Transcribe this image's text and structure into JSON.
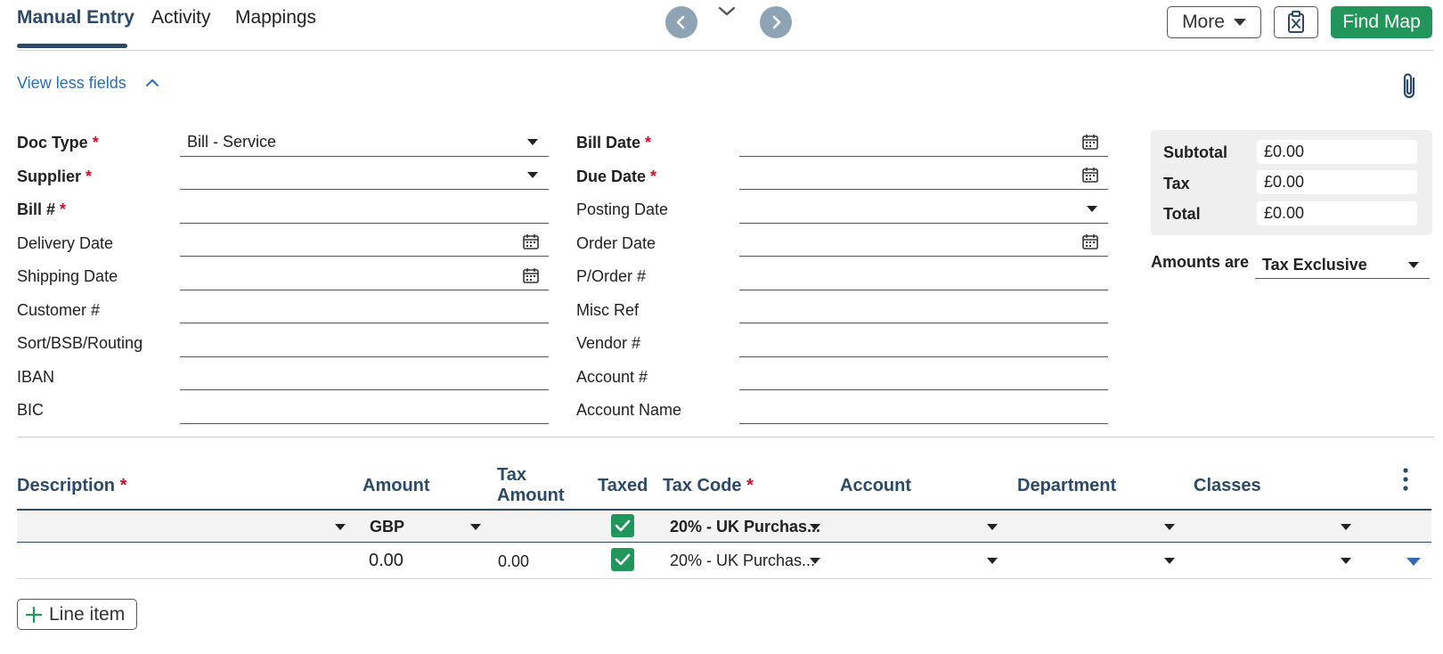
{
  "tabs": [
    {
      "label": "Manual Entry",
      "active": true
    },
    {
      "label": "Activity",
      "active": false
    },
    {
      "label": "Mappings",
      "active": false
    }
  ],
  "toolbar": {
    "more_label": "More",
    "find_map_label": "Find Map",
    "brand_green": "#22965a",
    "nav_gray": "#8ea3b3"
  },
  "view_toggle_label": "View less fields",
  "required_mark": "*",
  "left_fields": [
    {
      "label": "Doc Type",
      "required": true,
      "value": "Bill - Service",
      "control": "dropdown"
    },
    {
      "label": "Supplier",
      "required": true,
      "value": "",
      "control": "dropdown"
    },
    {
      "label": "Bill #",
      "required": true,
      "value": "",
      "control": "text"
    },
    {
      "label": "Delivery Date",
      "required": false,
      "value": "",
      "control": "date"
    },
    {
      "label": "Shipping Date",
      "required": false,
      "value": "",
      "control": "date"
    },
    {
      "label": "Customer #",
      "required": false,
      "value": "",
      "control": "text"
    },
    {
      "label": "Sort/BSB/Routing",
      "required": false,
      "value": "",
      "control": "text"
    },
    {
      "label": "IBAN",
      "required": false,
      "value": "",
      "control": "text"
    },
    {
      "label": "BIC",
      "required": false,
      "value": "",
      "control": "text"
    }
  ],
  "right_fields": [
    {
      "label": "Bill Date",
      "required": true,
      "value": "",
      "control": "date"
    },
    {
      "label": "Due Date",
      "required": true,
      "value": "",
      "control": "date"
    },
    {
      "label": "Posting Date",
      "required": false,
      "value": "",
      "control": "dropdown"
    },
    {
      "label": "Order Date",
      "required": false,
      "value": "",
      "control": "date"
    },
    {
      "label": "P/Order #",
      "required": false,
      "value": "",
      "control": "text"
    },
    {
      "label": "Misc Ref",
      "required": false,
      "value": "",
      "control": "text"
    },
    {
      "label": "Vendor #",
      "required": false,
      "value": "",
      "control": "text"
    },
    {
      "label": "Account #",
      "required": false,
      "value": "",
      "control": "text"
    },
    {
      "label": "Account Name",
      "required": false,
      "value": "",
      "control": "text"
    }
  ],
  "totals": {
    "subtotal_label": "Subtotal",
    "subtotal_value": "£0.00",
    "tax_label": "Tax",
    "tax_value": "£0.00",
    "total_label": "Total",
    "total_value": "£0.00"
  },
  "amounts_are": {
    "label": "Amounts are",
    "value": "Tax Exclusive"
  },
  "line_table": {
    "headers": {
      "description": "Description",
      "amount": "Amount",
      "tax_amount_line1": "Tax",
      "tax_amount_line2": "Amount",
      "taxed": "Taxed",
      "tax_code": "Tax Code",
      "account": "Account",
      "department": "Department",
      "classes": "Classes"
    },
    "default_row": {
      "currency": "GBP",
      "taxed": true,
      "tax_code": "20% - UK Purchas..."
    },
    "rows": [
      {
        "amount": "0.00",
        "tax_amount": "0.00",
        "taxed": true,
        "tax_code": "20% - UK Purchas..."
      }
    ],
    "add_line_label": "Line item"
  }
}
